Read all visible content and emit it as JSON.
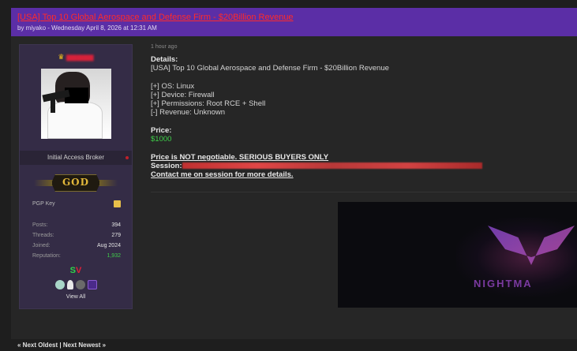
{
  "thread": {
    "title": "[USA] Top 10 Global Aerospace and Defense Firm - $20Billion Revenue",
    "meta": "by miyako - Wednesday April 8, 2026 at 12:31 AM"
  },
  "user": {
    "rank_title": "Initial Access Broker",
    "group_badge": "GOD",
    "pgp_label": "PGP Key",
    "stats": [
      {
        "key": "Posts:",
        "value": "394"
      },
      {
        "key": "Threads:",
        "value": "279"
      },
      {
        "key": "Joined:",
        "value": "Aug 2024"
      },
      {
        "key": "Reputation:",
        "value": "1,932"
      }
    ],
    "sv_s": "S",
    "sv_v": "V",
    "view_all": "View All",
    "icons": [
      "crown-icon",
      "pgp-key-icon",
      "online-status-icon"
    ]
  },
  "post": {
    "time": "1 hour ago",
    "details_label": "Details:",
    "details_text": "[USA] Top 10 Global Aerospace and Defense Firm -  $20Billion Revenue",
    "specs": [
      "[+] OS: Linux",
      "[+] Device: Firewall",
      "[+] Permissions: Root RCE + Shell",
      "[-] Revenue: Unknown"
    ],
    "price_label": "Price:",
    "price_value": "$1000",
    "notice": "Price is NOT negotiable. SERIOUS BUYERS ONLY",
    "session_label": "Session:",
    "contact": "Contact me on session for more details.",
    "banner_text": "NIGHTMA"
  },
  "footer": {
    "prev": "« Next Oldest",
    "sep": " | ",
    "next": "Next Newest »"
  },
  "colors": {
    "header_bg": "#5b2ea6",
    "title": "#ff2a2a",
    "price": "#3fd04a",
    "user_panel": "#342c46"
  }
}
